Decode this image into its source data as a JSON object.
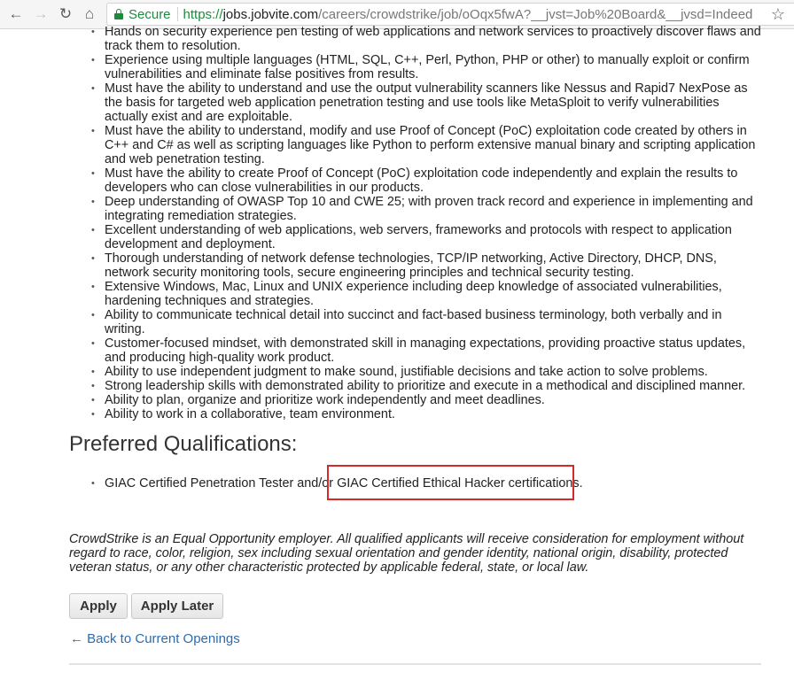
{
  "browser": {
    "secure_label": "Secure",
    "url_scheme": "https://",
    "url_host": "jobs.jobvite.com",
    "url_path": "/careers/crowdstrike/job/oOqx5fwA?__jvst=Job%20Board&__jvsd=Indeed",
    "icons": {
      "back": "←",
      "forward": "→",
      "reload": "↻",
      "home": "⌂",
      "bookmark": "☆"
    }
  },
  "requirements": [
    "Hands on security experience pen testing of web applications and network services to proactively discover flaws and track them to resolution.",
    "Experience using multiple languages (HTML, SQL, C++, Perl, Python, PHP or other) to manually exploit or confirm vulnerabilities and eliminate false positives from results.",
    "Must have the ability to understand and use the output vulnerability scanners like Nessus and Rapid7 NexPose as the basis for targeted web application penetration testing and use tools like MetaSploit to verify vulnerabilities actually exist and are exploitable.",
    "Must have the ability to understand, modify and use Proof of Concept (PoC) exploitation code created by others in C++ and C# as well as scripting languages like Python to perform extensive manual binary and scripting application and web penetration testing.",
    "Must have the ability to create Proof of Concept (PoC) exploitation code independently and explain the results to developers who can close vulnerabilities in our products.",
    "Deep understanding of OWASP Top 10 and CWE 25; with proven track record and experience in implementing and integrating remediation strategies.",
    "Excellent understanding of web applications, web servers, frameworks and protocols with respect to application development and deployment.",
    "Thorough understanding of network defense technologies, TCP/IP networking, Active Directory, DHCP, DNS, network security monitoring tools, secure engineering principles and technical security testing.",
    "Extensive Windows, Mac, Linux and UNIX experience including deep knowledge of associated vulnerabilities, hardening techniques and strategies.",
    "Ability to communicate technical detail into succinct and fact-based business terminology, both verbally and in writing.",
    "Customer-focused mindset, with demonstrated skill in managing expectations, providing proactive status updates, and producing high-quality work product.",
    "Ability to use independent judgment to make sound, justifiable decisions and take action to solve problems.",
    "Strong leadership skills with demonstrated ability to prioritize and execute in a methodical and disciplined manner.",
    "Ability to plan, organize and prioritize work independently and meet deadlines.",
    "Ability to work in a collaborative, team environment."
  ],
  "preferred": {
    "heading": "Preferred Qualifications:",
    "item_prefix": "GIAC Certified Penetration Tester and/or ",
    "item_highlight": "GIAC Certified Ethical Hacker certifications.",
    "highlight_color": "#d42a2a"
  },
  "eoe_statement": "CrowdStrike is an Equal Opportunity employer.  All qualified applicants will receive consideration for employment without regard to race, color, religion, sex including sexual orientation and gender identity, national origin, disability, protected veteran status, or any other characteristic protected by applicable federal, state, or local law.",
  "actions": {
    "apply_label": "Apply",
    "apply_later_label": "Apply Later",
    "back_link_label": "← Back to Current Openings"
  }
}
